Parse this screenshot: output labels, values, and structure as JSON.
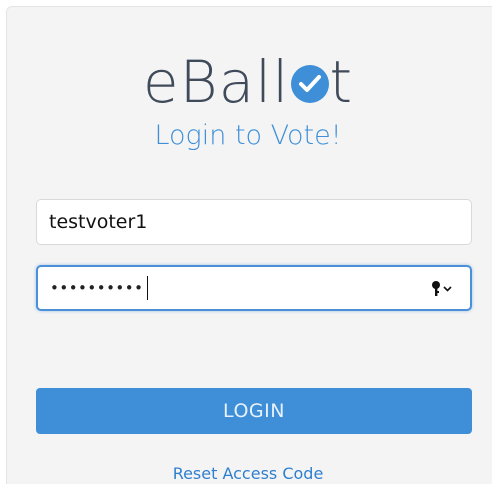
{
  "logo": {
    "text_before": "eBall",
    "text_after": "t",
    "check_icon": "check-circle-icon",
    "accent_color": "#3e8fd8",
    "text_color": "#3f4a5a"
  },
  "subtitle": "Login to Vote!",
  "username": {
    "value": "testvoter1"
  },
  "password": {
    "masked_value": "••••••••••",
    "key_icon": "key-icon",
    "dropdown_icon": "chevron-down-icon"
  },
  "login_button": {
    "label": "LOGIN",
    "color": "#3e8fd8"
  },
  "reset_link": {
    "label": "Reset Access Code"
  }
}
